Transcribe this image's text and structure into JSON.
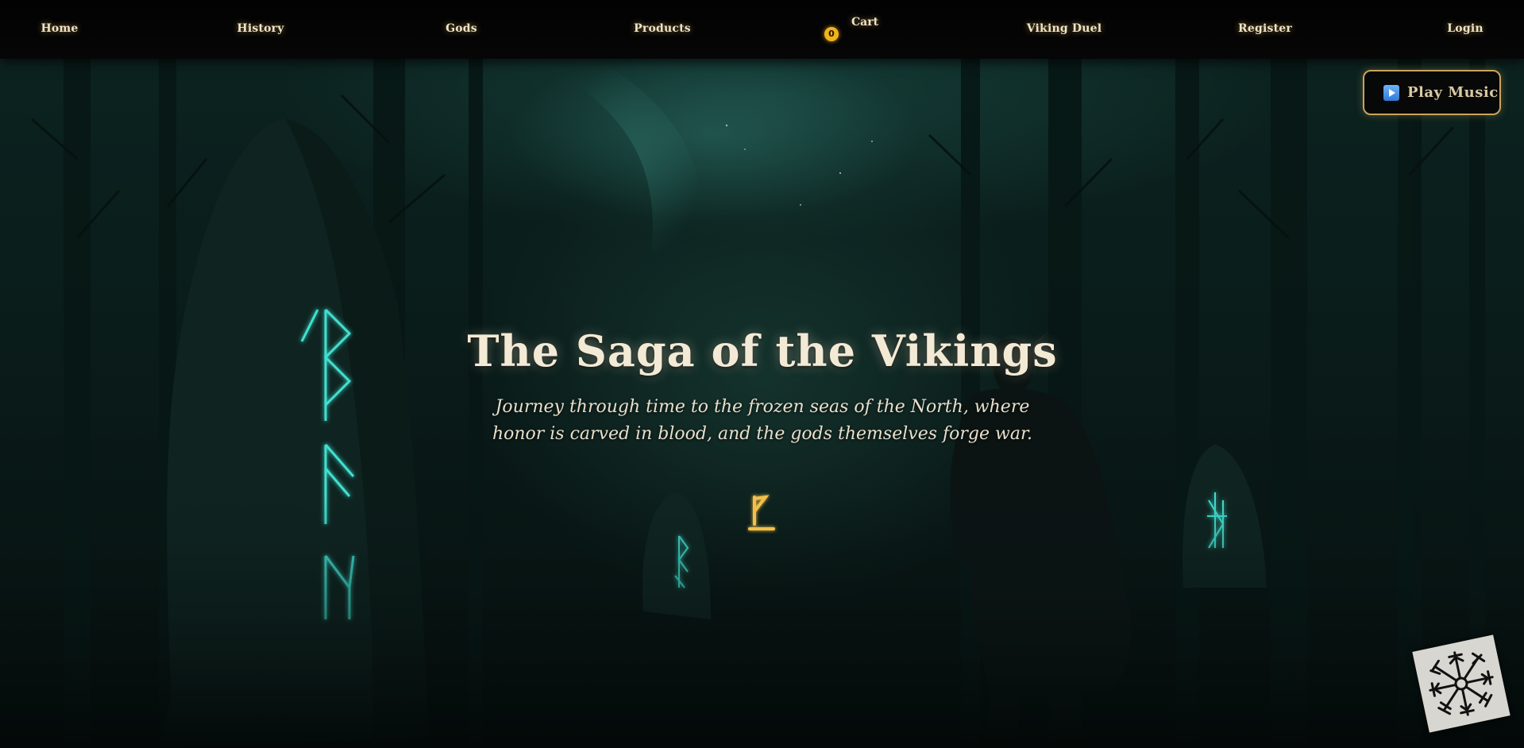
{
  "nav": {
    "home": "Home",
    "history": "History",
    "gods": "Gods",
    "products": "Products",
    "cart_label": "Cart",
    "cart_count": "0",
    "viking_duel": "Viking Duel",
    "register": "Register",
    "login": "Login"
  },
  "music_button": {
    "icon": "play-icon",
    "label": "Play Music"
  },
  "hero": {
    "title": "The Saga of the Vikings",
    "subtitle": "Journey through time to the frozen seas of the North, where honor is carved in blood, and the gods themselves forge war."
  },
  "icons": {
    "scroll_rune": "wunjo-rune-icon",
    "corner_emblem": "vegvisir-icon"
  },
  "colors": {
    "accent_gold": "#f2b21c",
    "rune_glow": "#3fe0d0",
    "button_border": "#c9a45c"
  }
}
